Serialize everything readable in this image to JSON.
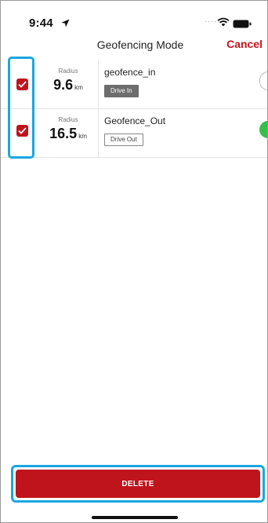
{
  "status_bar": {
    "time": "9:44",
    "icons": [
      "location-arrow-icon",
      "wifi-icon",
      "battery-icon"
    ]
  },
  "header": {
    "title": "Geofencing Mode",
    "cancel_label": "Cancel"
  },
  "geofences": [
    {
      "checked": true,
      "radius_label": "Radius",
      "radius_value": "9.6",
      "radius_unit": "km",
      "name": "geofence_in",
      "tag": "Drive In",
      "enabled": false
    },
    {
      "checked": true,
      "radius_label": "Radius",
      "radius_value": "16.5",
      "radius_unit": "km",
      "name": "Geofence_Out",
      "tag": "Drive Out",
      "enabled": true
    }
  ],
  "footer": {
    "delete_label": "DELETE"
  },
  "colors": {
    "accent": "#c0141c",
    "toggle_on": "#36c04a",
    "highlight": "#1aa6e2"
  }
}
